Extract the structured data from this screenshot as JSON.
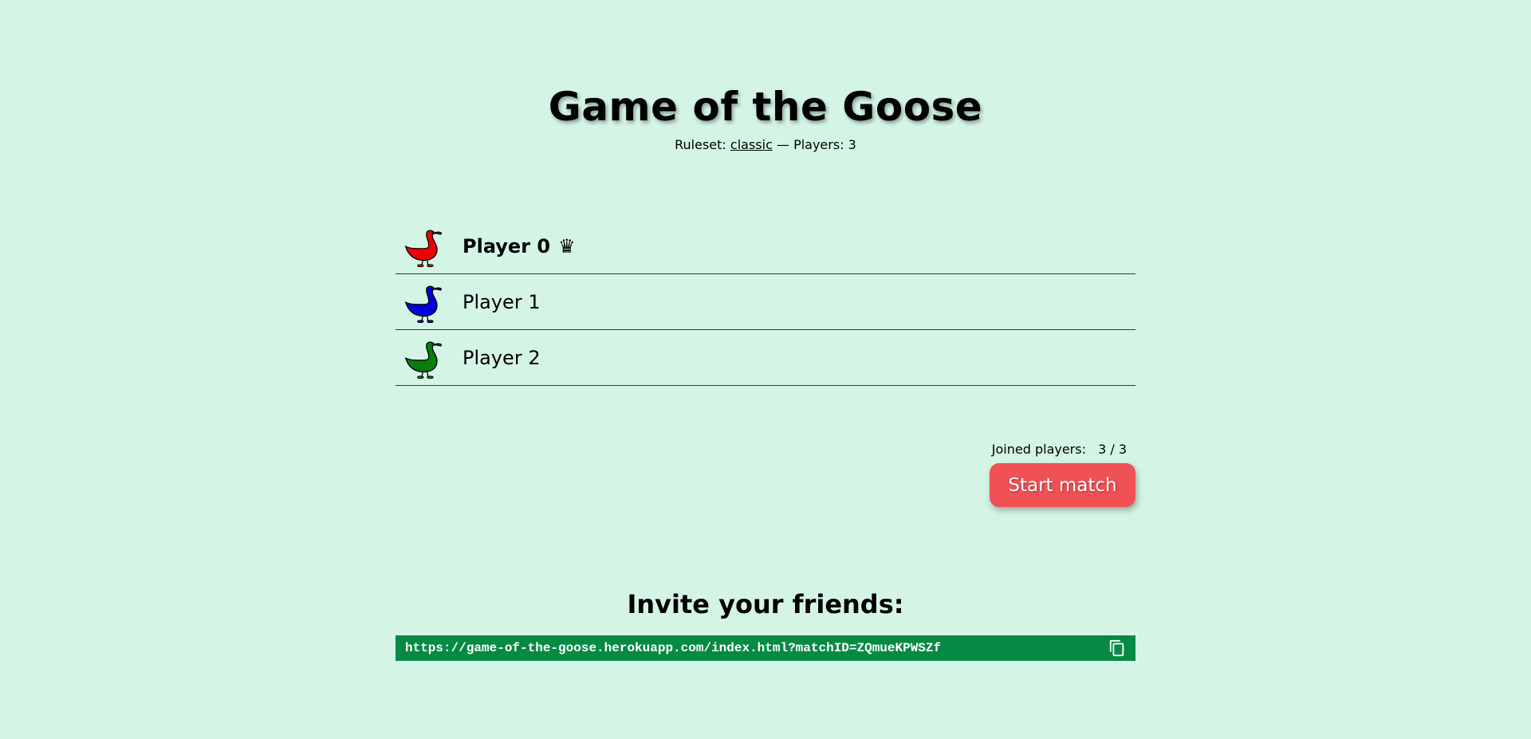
{
  "header": {
    "title": "Game of the Goose",
    "ruleset_label": "Ruleset:",
    "ruleset_value": "classic",
    "separator": "—",
    "players_label": "Players: 3"
  },
  "players": [
    {
      "name": "Player 0",
      "host": true,
      "host_icon": "♛",
      "color": "#ee0000"
    },
    {
      "name": "Player 1",
      "host": false,
      "color": "#0000dd"
    },
    {
      "name": "Player 2",
      "host": false,
      "color": "#0a7d0a"
    }
  ],
  "lobby": {
    "joined_label": "Joined players:",
    "joined_count": "3 / 3",
    "start_label": "Start match"
  },
  "invite": {
    "heading": "Invite your friends:",
    "url": "https://game-of-the-goose.herokuapp.com/index.html?matchID=ZQmueKPWSZf"
  },
  "colors": {
    "background": "#d4f5e6",
    "start_button": "#ef5155",
    "invite_box": "#058a43"
  },
  "icons": {
    "player_icon": "goose-icon",
    "host_icon": "crown-icon",
    "copy_icon": "copy-icon"
  }
}
